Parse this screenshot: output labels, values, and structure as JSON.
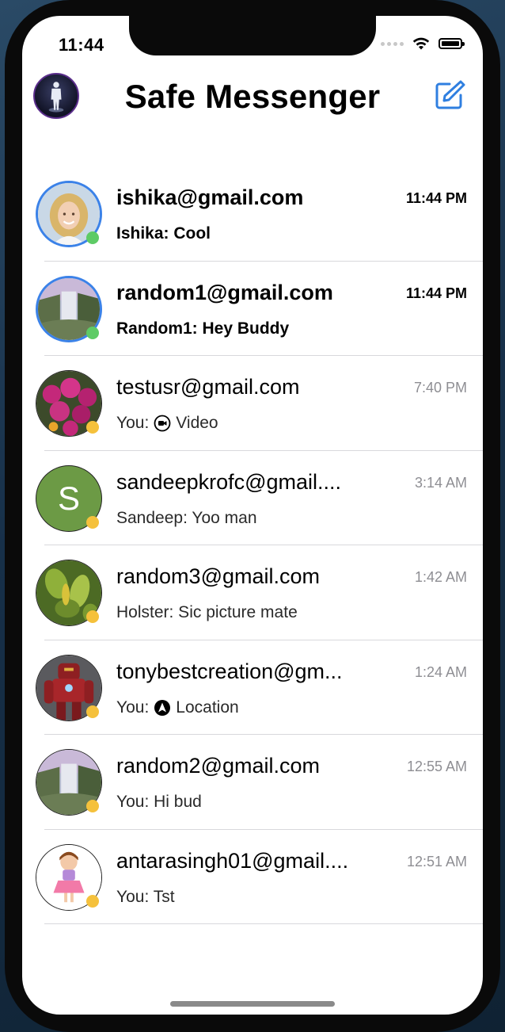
{
  "status_bar": {
    "time": "11:44"
  },
  "nav": {
    "title": "Safe Messenger"
  },
  "colors": {
    "accent": "#3b82e8",
    "online": "#5ecb66",
    "away": "#f5c13c"
  },
  "conversations": [
    {
      "name": "ishika@gmail.com",
      "time": "11:44 PM",
      "preview": "Ishika: Cool",
      "unread": true,
      "status": "online",
      "avatar": "woman-photo"
    },
    {
      "name": "random1@gmail.com",
      "time": "11:44 PM",
      "preview": "Random1: Hey Buddy",
      "unread": true,
      "status": "online",
      "avatar": "waterfall-photo"
    },
    {
      "name": "testusr@gmail.com",
      "time": "7:40 PM",
      "preview_prefix": "You:",
      "preview_icon": "video-icon",
      "preview": "Video",
      "unread": false,
      "status": "away",
      "avatar": "flowers-photo"
    },
    {
      "name": "sandeepkrofc@gmail....",
      "time": "3:14 AM",
      "preview": "Sandeep: Yoo man",
      "unread": false,
      "status": "away",
      "avatar": "letter",
      "avatar_letter": "S"
    },
    {
      "name": "random3@gmail.com",
      "time": "1:42 AM",
      "preview": "Holster: Sic picture mate",
      "unread": false,
      "status": "away",
      "avatar": "leaves-photo"
    },
    {
      "name": "tonybestcreation@gm...",
      "time": "1:24 AM",
      "preview_prefix": "You:",
      "preview_icon": "location-icon",
      "preview": "Location",
      "unread": false,
      "status": "away",
      "avatar": "robot-photo"
    },
    {
      "name": "random2@gmail.com",
      "time": "12:55 AM",
      "preview": "You: Hi bud",
      "unread": false,
      "status": "away",
      "avatar": "waterfall-photo"
    },
    {
      "name": "antarasingh01@gmail....",
      "time": "12:51 AM",
      "preview": "You: Tst",
      "unread": false,
      "status": "away",
      "avatar": "girl-cartoon"
    }
  ]
}
